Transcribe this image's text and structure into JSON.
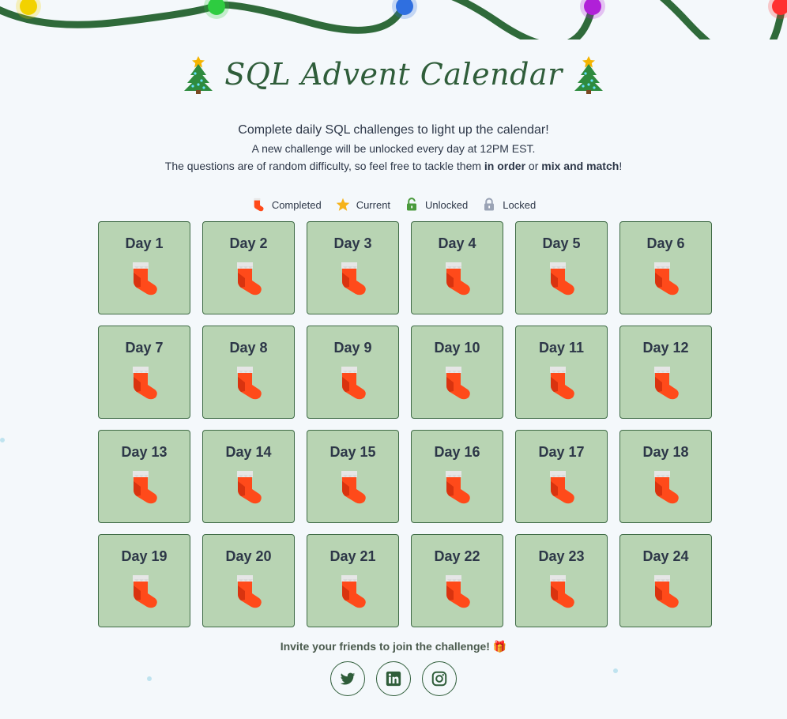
{
  "title": "SQL Advent Calendar",
  "subtitle": {
    "line1": "Complete daily SQL challenges to light up the calendar!",
    "line2": "A new challenge will be unlocked every day at 12PM EST.",
    "line3_before": "The questions are of random difficulty, so feel free to tackle them ",
    "line3_bold1": "in order",
    "line3_mid": " or ",
    "line3_bold2": "mix and match",
    "line3_after": "!"
  },
  "legend": [
    {
      "label": "Completed",
      "icon": "stocking-icon"
    },
    {
      "label": "Current",
      "icon": "star-icon"
    },
    {
      "label": "Unlocked",
      "icon": "unlocked-lock-icon"
    },
    {
      "label": "Locked",
      "icon": "locked-lock-icon"
    }
  ],
  "days": [
    {
      "label": "Day 1",
      "status": "completed"
    },
    {
      "label": "Day 2",
      "status": "completed"
    },
    {
      "label": "Day 3",
      "status": "completed"
    },
    {
      "label": "Day 4",
      "status": "completed"
    },
    {
      "label": "Day 5",
      "status": "completed"
    },
    {
      "label": "Day 6",
      "status": "completed"
    },
    {
      "label": "Day 7",
      "status": "completed"
    },
    {
      "label": "Day 8",
      "status": "completed"
    },
    {
      "label": "Day 9",
      "status": "completed"
    },
    {
      "label": "Day 10",
      "status": "completed"
    },
    {
      "label": "Day 11",
      "status": "completed"
    },
    {
      "label": "Day 12",
      "status": "completed"
    },
    {
      "label": "Day 13",
      "status": "completed"
    },
    {
      "label": "Day 14",
      "status": "completed"
    },
    {
      "label": "Day 15",
      "status": "completed"
    },
    {
      "label": "Day 16",
      "status": "completed"
    },
    {
      "label": "Day 17",
      "status": "completed"
    },
    {
      "label": "Day 18",
      "status": "completed"
    },
    {
      "label": "Day 19",
      "status": "completed"
    },
    {
      "label": "Day 20",
      "status": "completed"
    },
    {
      "label": "Day 21",
      "status": "completed"
    },
    {
      "label": "Day 22",
      "status": "completed"
    },
    {
      "label": "Day 23",
      "status": "completed"
    },
    {
      "label": "Day 24",
      "status": "completed"
    }
  ],
  "invite": {
    "text": "Invite your friends to join the challenge! 🎁"
  },
  "social": [
    {
      "name": "twitter",
      "icon": "twitter-icon"
    },
    {
      "name": "linkedin",
      "icon": "linkedin-icon"
    },
    {
      "name": "instagram",
      "icon": "instagram-icon"
    }
  ],
  "colors": {
    "background": "#f4f8fb",
    "title": "#2f5d3a",
    "card_fill": "#b8d4b3",
    "card_border": "#3f6b46",
    "garland": "#2f6a3a",
    "stocking": "#ff4a1a",
    "bulb_colors": [
      "#f2d200",
      "#2ecc40",
      "#2f6fe0",
      "#b020d8",
      "#ff3030"
    ]
  }
}
